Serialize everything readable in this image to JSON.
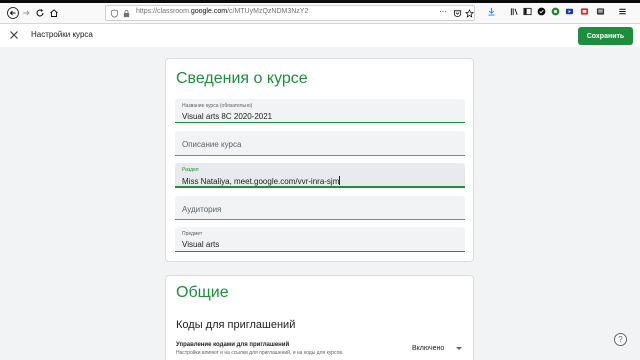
{
  "browser": {
    "url_prefix": "https://classroom.",
    "url_host": "google.com",
    "url_path": "/c/MTUyMzQzNDM3NzY2",
    "url_more": "···"
  },
  "header": {
    "title": "Настройки курса",
    "save_label": "Сохранить"
  },
  "course_details": {
    "heading": "Сведения о курсе",
    "fields": [
      {
        "label": "Название курса (обязательно)",
        "value": "Visual arts 8C 2020-2021"
      },
      {
        "placeholder": "Описание курса"
      },
      {
        "label": "Раздел",
        "value": "Miss Nataliya, meet.google.com/vvr-inra-sjm"
      },
      {
        "placeholder": "Аудитория"
      },
      {
        "label": "Предмет",
        "value": "Visual arts"
      }
    ]
  },
  "general": {
    "heading": "Общие",
    "invite_title": "Коды для приглашений",
    "invite_manage_label": "Управление кодами для приглашений",
    "invite_manage_desc": "Настройки влияют и на ссылки для приглашений, и на коды для курсов.",
    "invite_state": "Включено"
  },
  "help_label": "?"
}
